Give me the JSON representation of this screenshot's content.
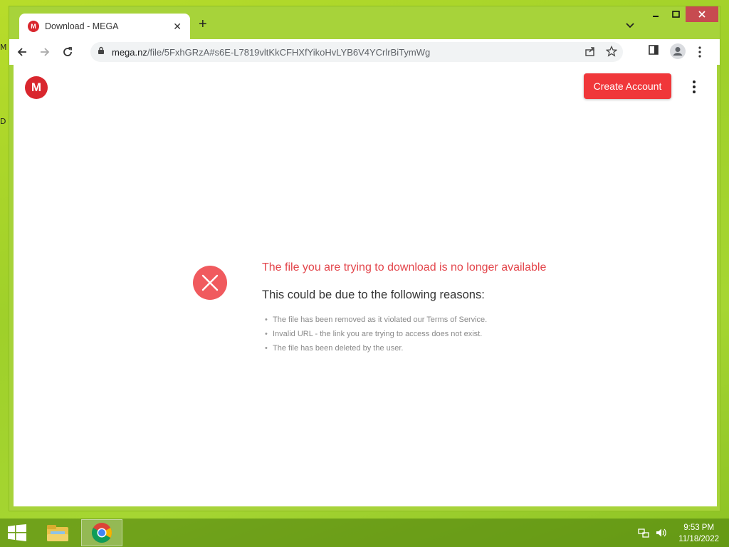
{
  "desktop": {
    "edge_letters": [
      "M",
      "D"
    ]
  },
  "browser": {
    "tab": {
      "title": "Download - MEGA",
      "favicon_letter": "M"
    },
    "new_tab_label": "+",
    "address": {
      "host": "mega.nz",
      "path": "/file/5FxhGRzA#s6E-L7819vltKkCFHXfYikoHvLYB6V4YCrlrBiTymWg"
    }
  },
  "page": {
    "logo_letter": "M",
    "create_account_label": "Create Account",
    "error_title": "The file you are trying to download is no longer available",
    "error_subtitle": "This could be due to the following reasons:",
    "reasons": [
      "The file has been removed as it violated our Terms of Service.",
      "Invalid URL - the link you are trying to access does not exist.",
      "The file has been deleted by the user."
    ]
  },
  "taskbar": {
    "time": "9:53 PM",
    "date": "11/18/2022"
  },
  "colors": {
    "mega_red": "#d9272e",
    "button_red": "#f0373a",
    "error_text": "#e3464c",
    "desktop_green": "#a6d632"
  }
}
